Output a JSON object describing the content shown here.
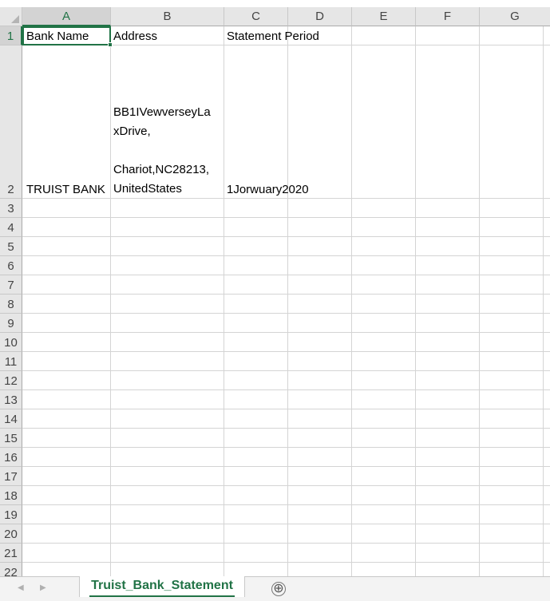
{
  "columns": [
    "A",
    "B",
    "C",
    "D",
    "E",
    "F",
    "G"
  ],
  "rows": [
    "1",
    "2",
    "3",
    "4",
    "5",
    "6",
    "7",
    "8",
    "9",
    "10",
    "11",
    "12",
    "13",
    "14",
    "15",
    "16",
    "17",
    "18",
    "19",
    "20",
    "21",
    "22"
  ],
  "cells": {
    "A1": "Bank Name",
    "B1": "Address",
    "C1": "Statement Period",
    "A2": "TRUIST BANK",
    "B2": "BB1IVewverseyLa\nxDrive,\n\nChariot,NC28213,\nUnitedStates",
    "C2": "1Jorwuary2020"
  },
  "selected_cell": "A1",
  "sheet_tab": {
    "label": "Truist_Bank_Statement"
  },
  "nav": {
    "prev": "◀",
    "next": "▶"
  },
  "add_sheet_icon": "⊕",
  "colors": {
    "accent": "#217346",
    "header_bg": "#e6e6e6",
    "gridline": "#d4d4d4"
  }
}
